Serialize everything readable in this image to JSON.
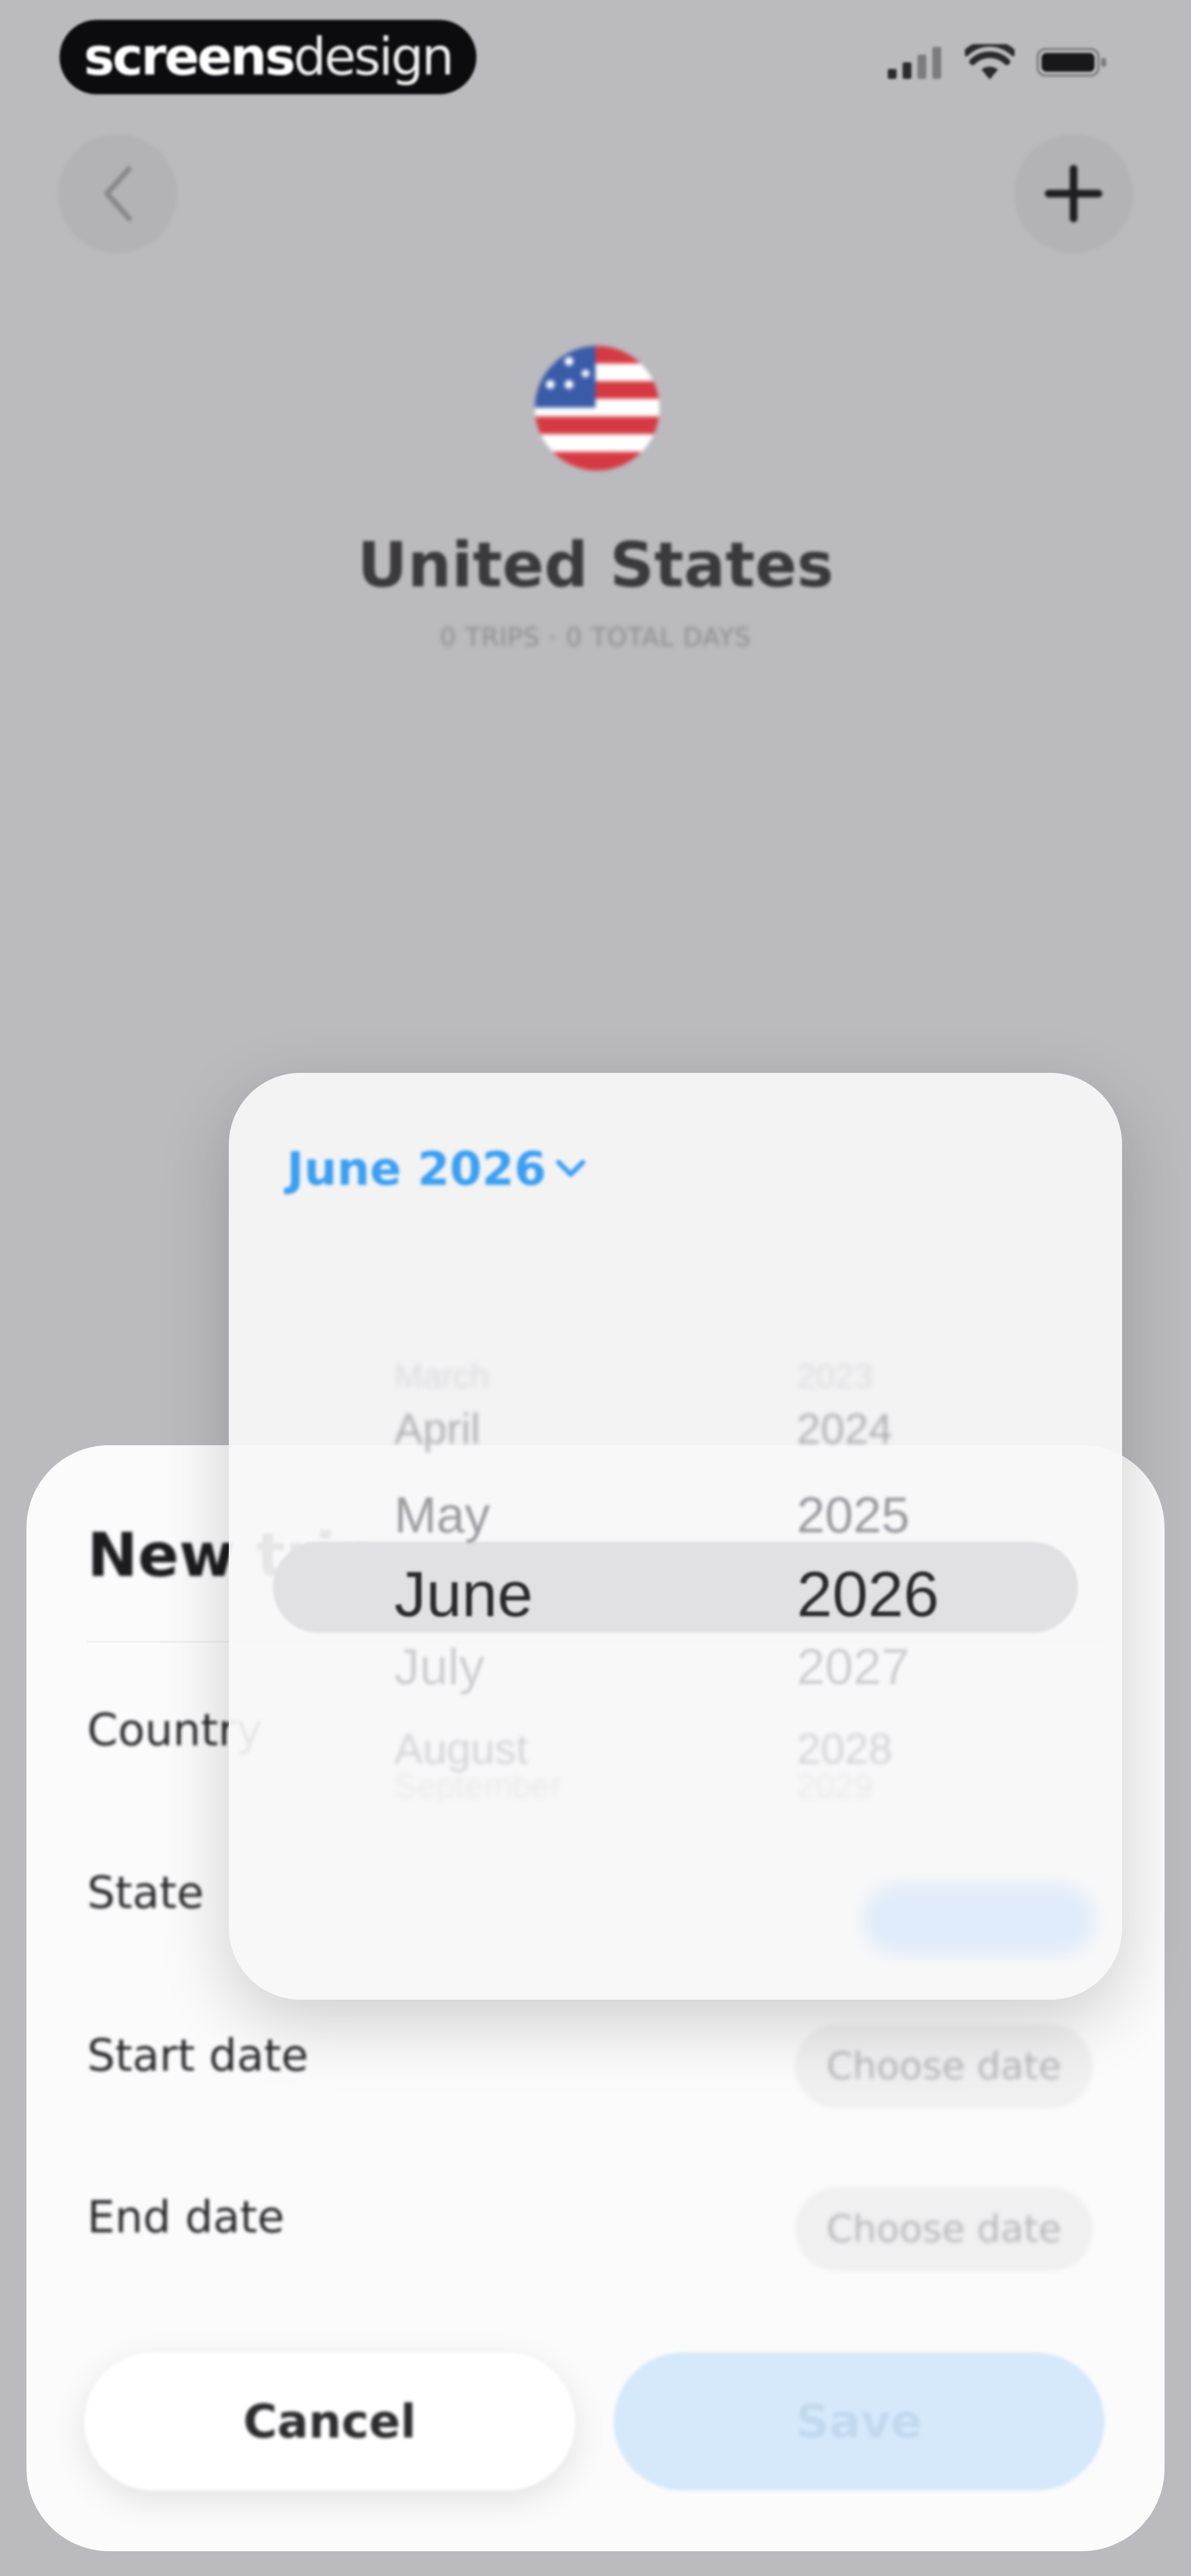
{
  "status_bar": {
    "brand_bold": "screens",
    "brand_light": "design"
  },
  "header": {
    "country": "United States",
    "meta": "0 TRIPS · 0 TOTAL DAYS"
  },
  "sheet": {
    "title": "New trip",
    "rows": {
      "country_label": "Country",
      "state_label": "State",
      "start_label": "Start date",
      "start_value": "Choose date",
      "end_label": "End date",
      "end_value": "Choose date"
    },
    "cancel_label": "Cancel",
    "save_label": "Save"
  },
  "picker": {
    "selected": "June 2026",
    "months": [
      "March",
      "April",
      "May",
      "June",
      "July",
      "August",
      "September"
    ],
    "years": [
      "2023",
      "2024",
      "2025",
      "2026",
      "2027",
      "2028",
      "2029"
    ],
    "selected_index": 3
  },
  "colors": {
    "accent": "#3b9ff2",
    "save_disabled_bg": "#d5e9fb",
    "backdrop": "#bbbabf"
  },
  "icons": {
    "back": "chevron-left-icon",
    "add": "plus-icon",
    "picker_toggle": "chevron-down-icon"
  }
}
